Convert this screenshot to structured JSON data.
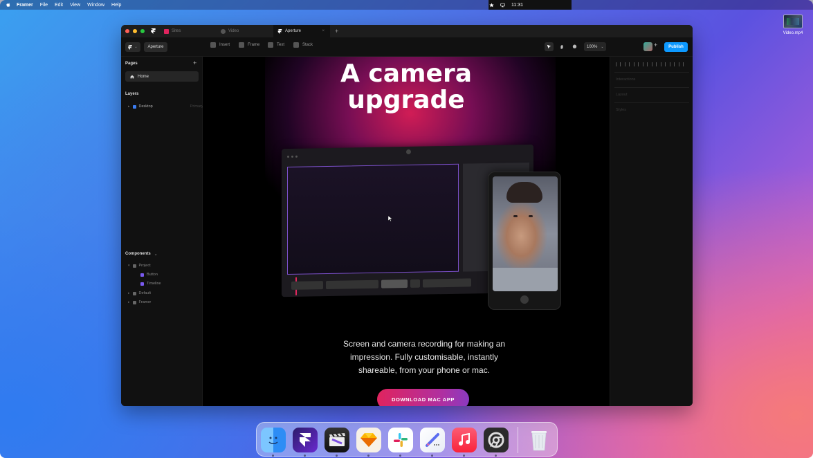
{
  "menubar": {
    "app": "Framer",
    "items": [
      "File",
      "Edit",
      "View",
      "Window",
      "Help"
    ],
    "clock": "11:31"
  },
  "desktop": {
    "file_name": "Video.mp4"
  },
  "window": {
    "tabs": [
      {
        "label": "Sites",
        "icon": "sites-icon",
        "color": "#e0245e"
      },
      {
        "label": "Video",
        "icon": "video-icon",
        "color": "#888888"
      },
      {
        "label": "Aperture",
        "icon": "framer-icon",
        "color": "#ffffff",
        "close": "×"
      }
    ],
    "new_tab": "+"
  },
  "toolbar": {
    "project_name": "Aperture",
    "tools": [
      "Insert",
      "Frame",
      "Text",
      "Stack"
    ],
    "zoom": "100%",
    "zoom_caret": "⌄",
    "add": "+",
    "publish": "Publish"
  },
  "left_panel": {
    "pages_title": "Pages",
    "pages_add": "+",
    "pages": [
      "Home"
    ],
    "layers_title": "Layers",
    "layers": [
      {
        "label": "Desktop",
        "meta": "Primary"
      }
    ],
    "components_title": "Components",
    "components_caret": "⌄",
    "components": [
      {
        "label": "Project",
        "type": "folder",
        "indent": 0
      },
      {
        "label": "Button",
        "type": "component",
        "indent": 1
      },
      {
        "label": "Timeline",
        "type": "component",
        "indent": 1
      },
      {
        "label": "Default",
        "type": "folder",
        "indent": 0
      },
      {
        "label": "Framer",
        "type": "folder",
        "indent": 0
      }
    ]
  },
  "canvas": {
    "headline_line1": "A camera",
    "headline_line2": "upgrade",
    "sub_line1": "Screen and camera recording for making an",
    "sub_line2": "impression. Fully customisable, instantly",
    "sub_line3": "shareable, from your phone or mac.",
    "cta": "DOWNLOAD MAC APP"
  },
  "right_panel": {
    "sections": [
      "Interactions",
      "Layout",
      "Styles"
    ]
  },
  "dock": {
    "apps": [
      "finder-icon",
      "framer-app-icon",
      "final-cut-icon",
      "sketch-icon",
      "slack-icon",
      "pixelmator-icon",
      "music-icon",
      "chrome-icon",
      "trash-icon"
    ]
  },
  "colors": {
    "accent_publish": "#0d99ff",
    "cta_start": "#e0245e",
    "cta_end": "#8a3ac0"
  }
}
